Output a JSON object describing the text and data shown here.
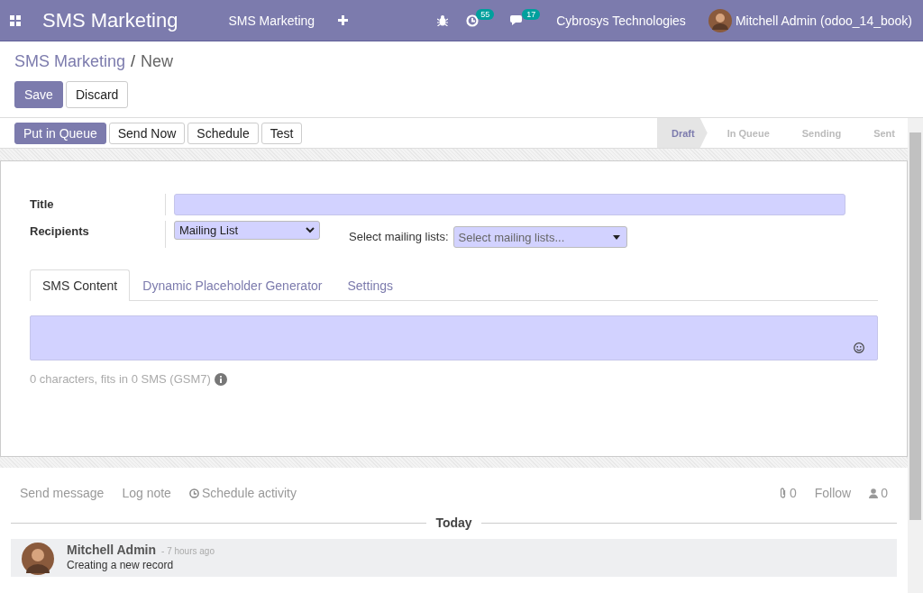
{
  "navbar": {
    "app_title": "SMS Marketing",
    "menu": [
      "SMS Marketing"
    ],
    "activity_count": "55",
    "message_count": "17",
    "company": "Cybrosys Technologies",
    "user": "Mitchell Admin (odoo_14_book)"
  },
  "breadcrumb": {
    "parent": "SMS Marketing",
    "separator": "/",
    "current": "New"
  },
  "form_buttons": [
    {
      "label": "Save",
      "kind": "primary"
    },
    {
      "label": "Discard",
      "kind": "secondary"
    }
  ],
  "action_buttons": [
    {
      "label": "Put in Queue",
      "kind": "primary"
    },
    {
      "label": "Send Now",
      "kind": "secondary"
    },
    {
      "label": "Schedule",
      "kind": "secondary"
    },
    {
      "label": "Test",
      "kind": "secondary"
    }
  ],
  "stages": [
    {
      "label": "Draft",
      "selected": true
    },
    {
      "label": "In Queue",
      "selected": false
    },
    {
      "label": "Sending",
      "selected": false
    },
    {
      "label": "Sent",
      "selected": false
    }
  ],
  "fields": {
    "title": {
      "label": "Title"
    },
    "recipients": {
      "label": "Recipients",
      "value": "Mailing List"
    },
    "mailing_lists": {
      "label": "Select mailing lists:",
      "placeholder": "Select mailing lists..."
    }
  },
  "tabs": [
    {
      "label": "SMS Content",
      "selected": true
    },
    {
      "label": "Dynamic Placeholder Generator",
      "selected": false
    },
    {
      "label": "Settings",
      "selected": false
    }
  ],
  "sms_content": {
    "counter": "0 characters, fits in 0 SMS (GSM7)"
  },
  "chatter": {
    "actions": [
      "Send message",
      "Log note",
      "Schedule activity"
    ],
    "attachment_count": "0",
    "follow": "Follow",
    "follower_count": "0",
    "date_separator": "Today",
    "messages": [
      {
        "author": "Mitchell Admin",
        "time": "- 7 hours ago",
        "body": "Creating a new record"
      }
    ]
  }
}
